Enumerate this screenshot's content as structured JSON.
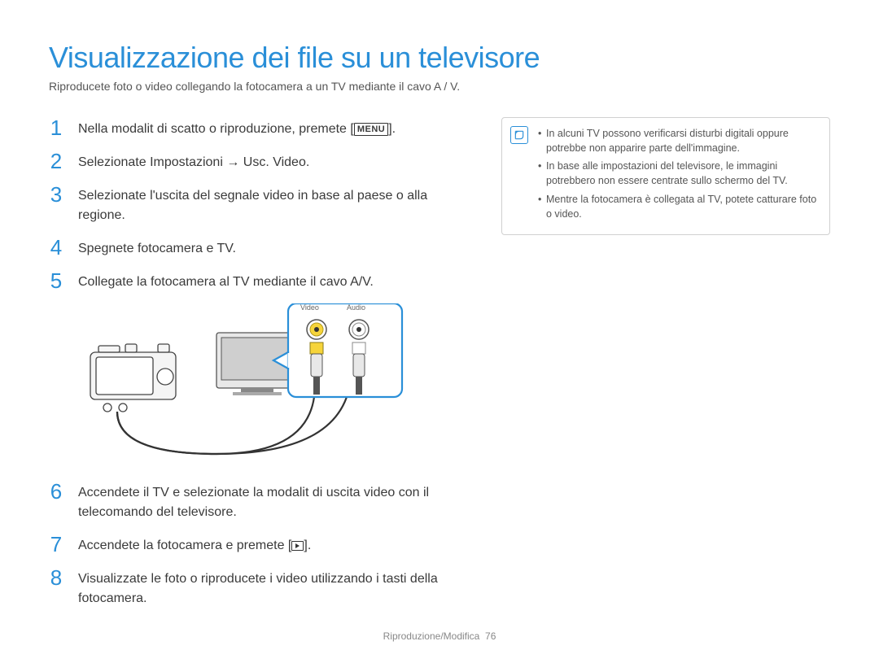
{
  "title": "Visualizzazione dei file su un televisore",
  "subtitle": "Riproducete foto o video collegando la fotocamera a un TV mediante il cavo A / V.",
  "steps": {
    "s1a": "Nella modalit  di scatto o riproduzione, premete [",
    "s1b": "].",
    "menu_label": "MENU",
    "s2": "Selezionate Impostazioni → Usc. Video.",
    "s3": "Selezionate l'uscita del segnale video in base al paese o alla regione.",
    "s4": "Spegnete fotocamera e TV.",
    "s5": "Collegate la fotocamera al TV mediante il cavo A/V.",
    "s6": "Accendete il TV e selezionate la modalit  di uscita video con il telecomando del televisore.",
    "s7a": "Accendete la fotocamera e premete [",
    "s7b": "].",
    "s8": "Visualizzate le foto o riproducete i video utilizzando i tasti della fotocamera."
  },
  "diagram": {
    "video_label": "Video",
    "audio_label": "Audio"
  },
  "notes": {
    "n1": "In alcuni TV possono verificarsi disturbi digitali oppure potrebbe non apparire parte dell'immagine.",
    "n2": "In base alle impostazioni del televisore, le immagini potrebbero non essere centrate sullo schermo del TV.",
    "n3": "Mentre la fotocamera è collegata al TV, potete catturare foto o video."
  },
  "footer": {
    "section": "Riproduzione/Modifica",
    "page": "76"
  }
}
